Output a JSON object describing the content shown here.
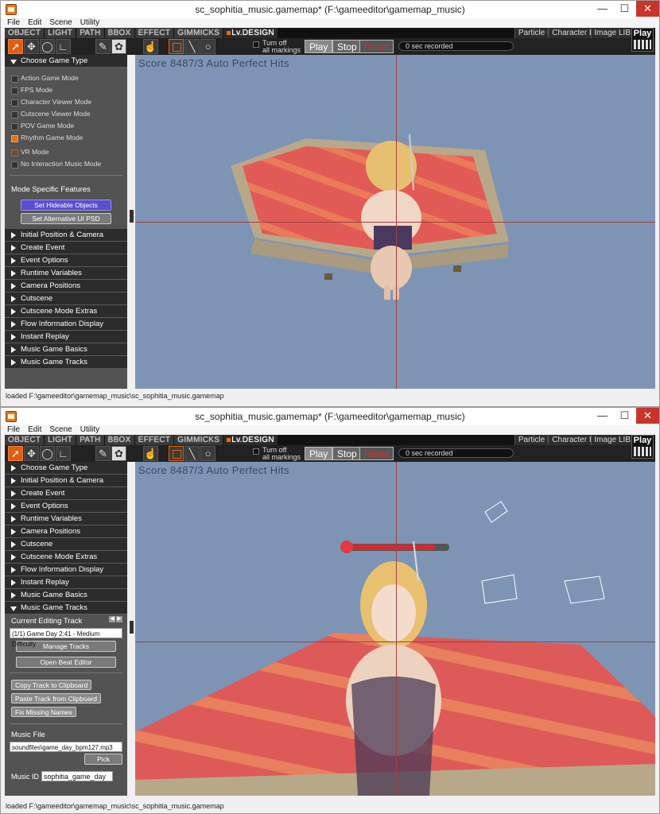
{
  "window": {
    "title": "sc_sophitia_music.gamemap* (F:\\gameeditor\\gamemap_music)",
    "min_glyph": "—",
    "max_glyph": "☐",
    "close_glyph": "✕"
  },
  "menu": [
    "File",
    "Edit",
    "Scene",
    "Utility"
  ],
  "tabs": [
    "OBJECT",
    "LIGHT",
    "PATH",
    "BBOX",
    "EFFECT",
    "GIMMICKS",
    "Lv.DESIGN"
  ],
  "libs": [
    "Particle LIB",
    "Character LIB",
    "Image LIB"
  ],
  "toolbar": {
    "turn_off_1": "Turn off",
    "turn_off_2": "all markings",
    "play": "Play",
    "stop": "Stop",
    "reset": "Reset",
    "recorded": "0 sec recorded",
    "play_big": "Play"
  },
  "viewport": {
    "score": "Score 8487/3 Auto Perfect Hits"
  },
  "status": "loaded F:\\gameeditor\\gamemap_music\\sc_sophitia_music.gamemap",
  "panel1": {
    "header": "Choose Game Type",
    "modes": [
      "Action Game Mode",
      "FPS Mode",
      "Character Viewer Mode",
      "Cutscene Viewer Mode",
      "POV Game Mode",
      "Rhythm Game Mode",
      "VR Mode",
      "No Interaction Music Mode"
    ],
    "features_title": "Mode Specific Features",
    "btn_hideable": "Set Hideable Objects",
    "btn_alt_ui": "Set Alternative UI PSD",
    "sections": [
      "Initial Position & Camera",
      "Create Event",
      "Event Options",
      "Runtime Variables",
      "Camera Positions",
      "Cutscene",
      "Cutscene Mode Extras",
      "Flow Information Display",
      "Instant Replay",
      "Music Game Basics",
      "Music Game Tracks"
    ]
  },
  "panel2": {
    "sections": [
      "Choose Game Type",
      "Initial Position & Camera",
      "Create Event",
      "Event Options",
      "Runtime Variables",
      "Camera Positions",
      "Cutscene",
      "Cutscene Mode Extras",
      "Flow Information Display",
      "Instant Replay",
      "Music Game Basics",
      "Music Game Tracks"
    ],
    "editing_track_label": "Current Editing Track",
    "track_value": "(1/1) Game Day 2:41 - Medium Difficulty",
    "manage_tracks": "Manage Tracks",
    "open_beat_editor": "Open Beat Editor",
    "copy_track": "Copy Track to Clipboard",
    "paste_track": "Paste Track from Clipboard",
    "fix_missing": "Fix Missing Names",
    "music_file_label": "Music File",
    "music_file_value": "soundfiles\\game_day_bpm127.mp3",
    "pick": "Pick",
    "music_id_label": "Music ID",
    "music_id_value": "sophitia_game_day"
  },
  "colors": {
    "accent_orange": "#e25c11",
    "viewport_sky": "#7d94b4",
    "panel_bg": "#535353",
    "header_bg": "#2c2c2c",
    "blue_button": "#5a4fcf"
  }
}
